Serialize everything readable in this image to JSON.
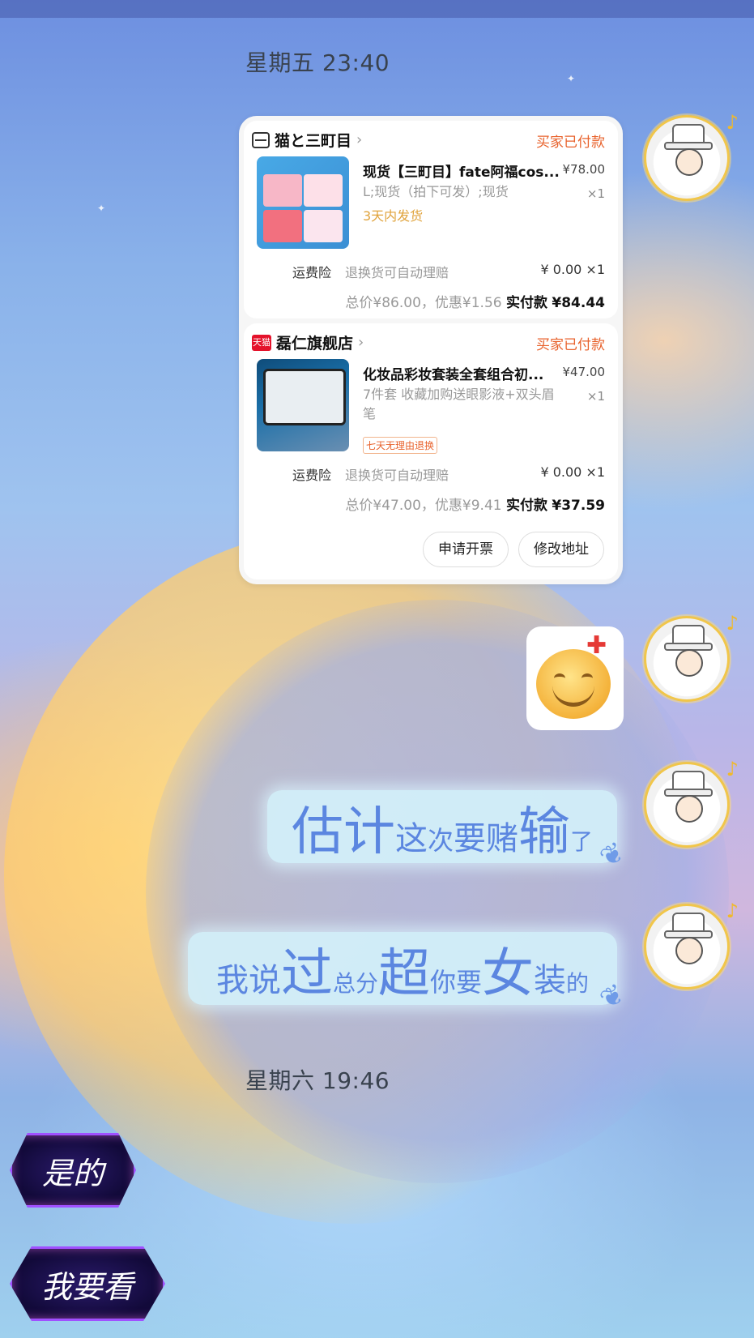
{
  "timestamps": {
    "first": "星期五 23:40",
    "second": "星期六 19:46"
  },
  "order_card": {
    "shops": [
      {
        "name": "猫と三町目",
        "status": "买家已付款",
        "item_title": "现货【三町目】fate阿福cos...",
        "item_price": "¥78.00",
        "item_spec": "L;现货（拍下可发）;现货",
        "item_qty": "×1",
        "ship_note": "3天内发货",
        "insurance_label": "运费险",
        "insurance_desc": "退换货可自动理赔",
        "insurance_price": "¥ 0.00 ×1",
        "total_text": "总价¥86.00，优惠¥1.56",
        "paid_label": "实付款",
        "paid_amount": "¥84.44"
      },
      {
        "name": "磊仁旗舰店",
        "status": "买家已付款",
        "store_badge": "天猫",
        "item_title": "化妆品彩妆套装全套组合初...",
        "item_price": "¥47.00",
        "item_spec": "7件套  收藏加购送眼影液+双头眉笔",
        "item_qty": "×1",
        "return_badge": "七天无理由退换",
        "insurance_label": "运费险",
        "insurance_desc": "退换货可自动理赔",
        "insurance_price": "¥ 0.00 ×1",
        "total_text": "总价¥47.00，优惠¥9.41",
        "paid_label": "实付款",
        "paid_amount": "¥37.59"
      }
    ],
    "buttons": {
      "invoice": "申请开票",
      "modify_address": "修改地址"
    }
  },
  "messages": {
    "msg1": {
      "p1": "估计",
      "p2": "这",
      "p3": "次",
      "p4": "要赌",
      "p5": "输",
      "p6": "了"
    },
    "msg2": {
      "p1": "我说",
      "p2": "过",
      "p3": "总分",
      "p4": "超",
      "p5": "你要",
      "p6": "女",
      "p7": "装",
      "p8": "的"
    }
  },
  "quick_replies": [
    "是的",
    "我要看"
  ],
  "colors": {
    "paid_status": "#e8622c",
    "bubble_text": "#5b86e0",
    "quick_reply_glow": "#a050ff"
  },
  "icons": {
    "shop": "shop-icon",
    "tmall": "tmall-icon",
    "sticker": "angry-smiley-sticker"
  }
}
